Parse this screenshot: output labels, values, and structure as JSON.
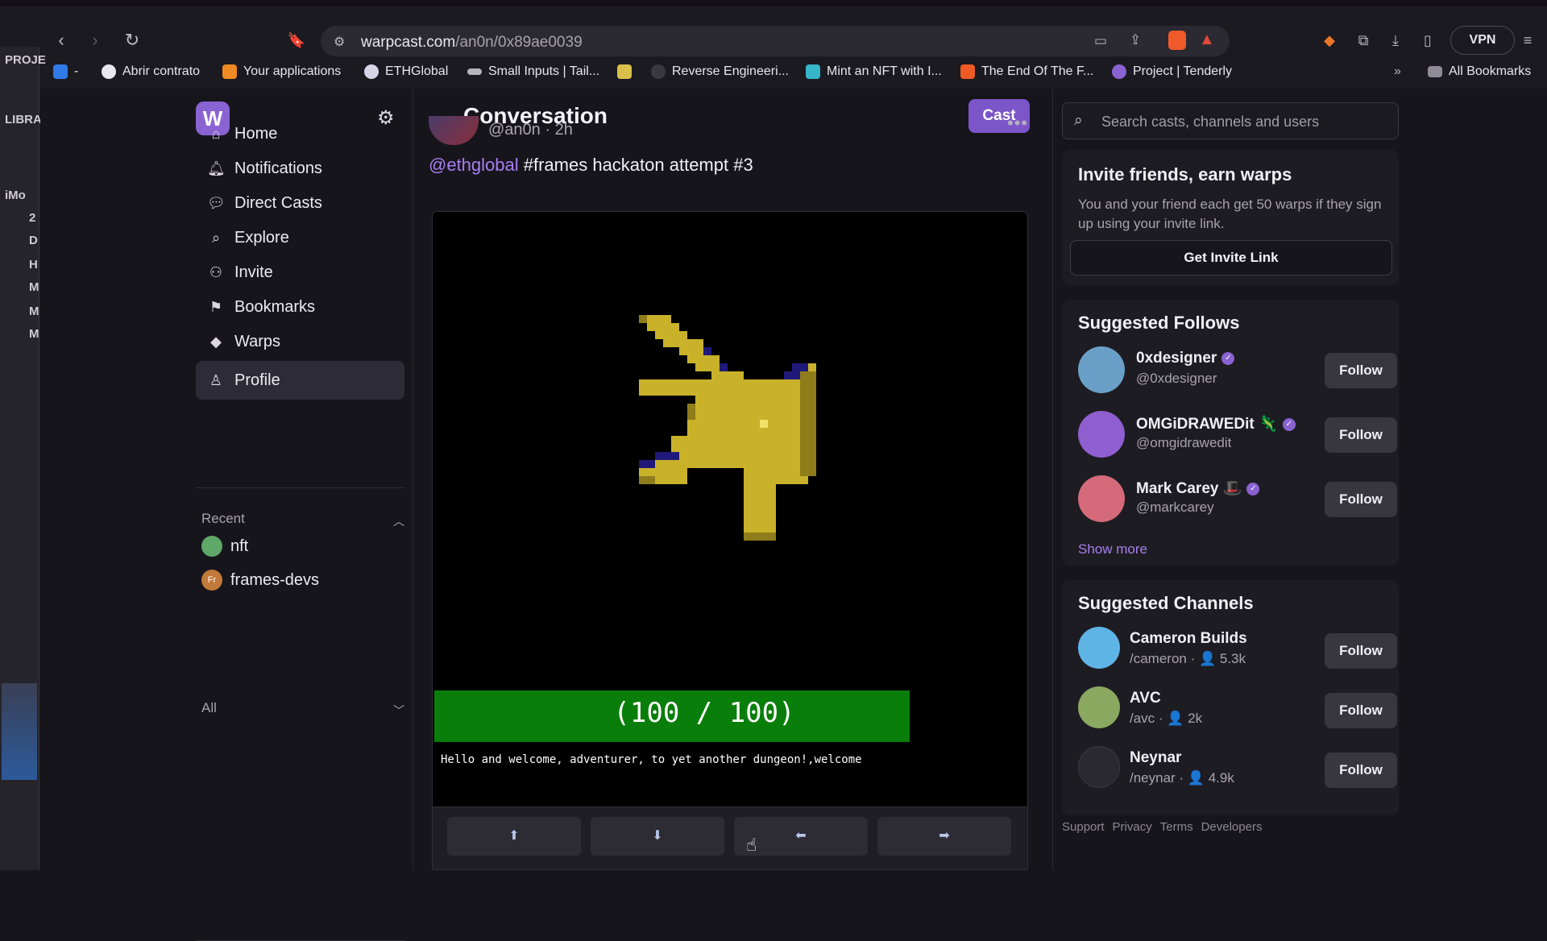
{
  "browser": {
    "url_host": "warpcast.com",
    "url_path": "/an0n/0x89ae0039",
    "vpn_label": "VPN",
    "bookmarks": [
      {
        "label": "Abrir contrato",
        "color": "#e8e6ee"
      },
      {
        "label": "Your applications",
        "color": "#f08a24"
      },
      {
        "label": "ETHGlobal",
        "color": "#d8d4e8"
      },
      {
        "label": "Small Inputs | Tail...",
        "color": "#b7b4c0"
      },
      {
        "label": "Reverse Engineeri...",
        "color": "#3a3840"
      },
      {
        "label": "Mint an NFT with I...",
        "color": "#35b6c9"
      },
      {
        "label": "The End Of The F...",
        "color": "#f05a24"
      },
      {
        "label": "Project | Tenderly",
        "color": "#8a63d2"
      }
    ],
    "all_bookmarks": "All Bookmarks"
  },
  "side_strip": [
    "PROJE",
    "LIBRA",
    "iMo",
    "2",
    "D",
    "H",
    "M",
    "M",
    "M"
  ],
  "sidebar": {
    "logo": "W",
    "nav": [
      {
        "label": "Home",
        "icon": "home-icon",
        "glyph": "⌂"
      },
      {
        "label": "Notifications",
        "icon": "bell-icon",
        "glyph": "🔔"
      },
      {
        "label": "Direct Casts",
        "icon": "chat-icon",
        "glyph": "💬"
      },
      {
        "label": "Explore",
        "icon": "search-icon",
        "glyph": "⌕"
      },
      {
        "label": "Invite",
        "icon": "users-icon",
        "glyph": "👥"
      },
      {
        "label": "Bookmarks",
        "icon": "bookmark-icon",
        "glyph": "🔖"
      },
      {
        "label": "Warps",
        "icon": "diamond-icon",
        "glyph": "◆"
      },
      {
        "label": "Profile",
        "icon": "person-icon",
        "glyph": "👤"
      }
    ],
    "recent_label": "Recent",
    "recent": [
      {
        "label": "nft",
        "avatar_color": "#5fa86a",
        "avatar_text": ""
      },
      {
        "label": "frames-devs",
        "avatar_color": "#c27a3a",
        "avatar_text": "Fr"
      }
    ],
    "all_label": "All"
  },
  "conversation": {
    "title": "Conversation",
    "cast_button": "Cast",
    "handle": "@an0n · 2h",
    "mention": "@ethglobal",
    "text": " #frames hackaton attempt #3",
    "frame": {
      "hp": "(100 / 100)",
      "hp_fraction": 1.0,
      "message": "Hello and welcome, adventurer, to yet another dungeon!,welcome",
      "buttons": [
        {
          "glyph": "⬆",
          "icon": "up-arrow-icon"
        },
        {
          "glyph": "⬇",
          "icon": "down-arrow-icon"
        },
        {
          "glyph": "⬅",
          "icon": "left-arrow-icon"
        },
        {
          "glyph": "➡",
          "icon": "right-arrow-icon"
        }
      ]
    }
  },
  "right": {
    "search_placeholder": "Search casts, channels and users",
    "invite": {
      "title": "Invite friends, earn warps",
      "desc": "You and your friend each get 50 warps if they sign up using your invite link.",
      "button": "Get Invite Link"
    },
    "suggested_follows": {
      "title": "Suggested Follows",
      "users": [
        {
          "name": "0xdesigner",
          "handle": "@0xdesigner",
          "follow": "Follow",
          "avatar_color": "#6aa0c8"
        },
        {
          "name": "OMGiDRAWEDit 🦎",
          "handle": "@omgidrawedit",
          "follow": "Follow",
          "avatar_color": "#8f5fd0"
        },
        {
          "name": "Mark Carey 🎩",
          "handle": "@markcarey",
          "follow": "Follow",
          "avatar_color": "#d46a7a"
        }
      ],
      "show_more": "Show more"
    },
    "suggested_channels": {
      "title": "Suggested Channels",
      "channels": [
        {
          "name": "Cameron Builds",
          "meta": "/cameron · 👤 5.3k",
          "follow": "Follow",
          "avatar_color": "#5fb4e6"
        },
        {
          "name": "AVC",
          "meta": "/avc · 👤 2k",
          "follow": "Follow",
          "avatar_color": "#8aa860"
        },
        {
          "name": "Neynar",
          "meta": "/neynar · 👤 4.9k",
          "follow": "Follow",
          "avatar_color": "#2a2830"
        }
      ]
    },
    "footer": [
      "Support",
      "Privacy",
      "Terms",
      "Developers"
    ]
  }
}
